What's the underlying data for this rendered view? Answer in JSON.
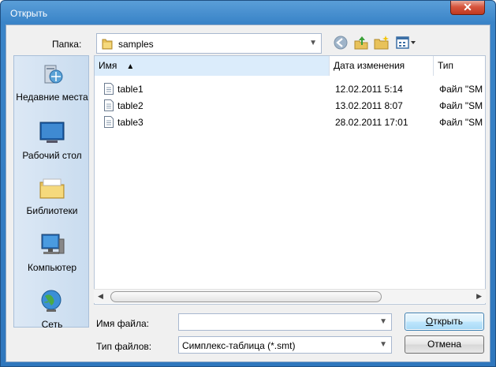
{
  "window": {
    "title": "Открыть",
    "close_glyph": "✕"
  },
  "location": {
    "label": "Папка:",
    "folder": "samples"
  },
  "toolbar": {
    "icons": [
      "back-icon",
      "up-folder-icon",
      "new-folder-icon",
      "view-menu-icon"
    ]
  },
  "places": [
    {
      "name": "recent",
      "label": "Недавние места",
      "icon": "recent-places-icon"
    },
    {
      "name": "desktop",
      "label": "Рабочий стол",
      "icon": "desktop-icon"
    },
    {
      "name": "libraries",
      "label": "Библиотеки",
      "icon": "libraries-icon"
    },
    {
      "name": "computer",
      "label": "Компьютер",
      "icon": "computer-icon"
    },
    {
      "name": "network",
      "label": "Сеть",
      "icon": "network-icon"
    }
  ],
  "filelist": {
    "columns": {
      "name": "Имя",
      "date": "Дата изменения",
      "type": "Тип"
    },
    "sort_glyph": "▲",
    "rows": [
      {
        "name": "table1",
        "date": "12.02.2011 5:14",
        "type": "Файл \"SM"
      },
      {
        "name": "table2",
        "date": "13.02.2011 8:07",
        "type": "Файл \"SM"
      },
      {
        "name": "table3",
        "date": "28.02.2011 17:01",
        "type": "Файл \"SM"
      }
    ]
  },
  "filename": {
    "label": "Имя файла:",
    "value": ""
  },
  "filetype": {
    "label": "Тип файлов:",
    "value": "Симплекс-таблица (*.smt)"
  },
  "buttons": {
    "open_first": "О",
    "open_rest": "ткрыть",
    "cancel": "Отмена"
  }
}
